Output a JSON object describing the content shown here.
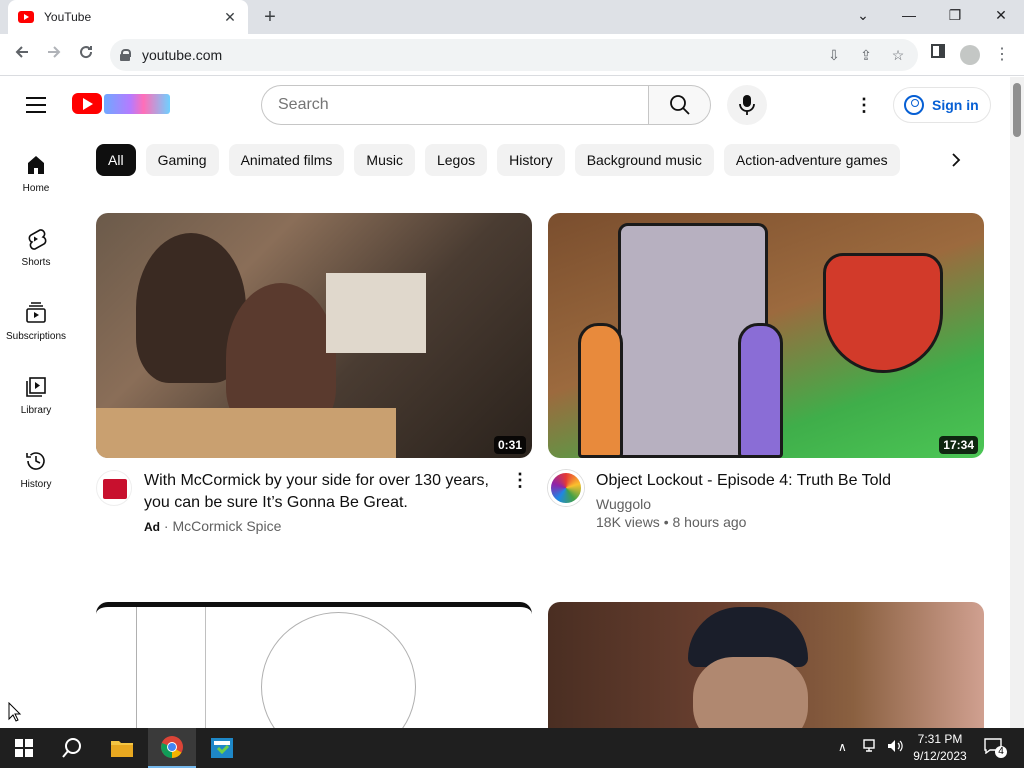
{
  "browser": {
    "tab_title": "YouTube",
    "url": "youtube.com"
  },
  "header": {
    "search_placeholder": "Search",
    "signin_label": "Sign in"
  },
  "sidebar": {
    "items": [
      {
        "label": "Home",
        "icon": "home-icon"
      },
      {
        "label": "Shorts",
        "icon": "shorts-icon"
      },
      {
        "label": "Subscriptions",
        "icon": "subscriptions-icon"
      },
      {
        "label": "Library",
        "icon": "library-icon"
      },
      {
        "label": "History",
        "icon": "history-icon"
      }
    ]
  },
  "chips": [
    "All",
    "Gaming",
    "Animated films",
    "Music",
    "Legos",
    "History",
    "Background music",
    "Action-adventure games"
  ],
  "videos": [
    {
      "title": "With McCormick by your side for over 130 years, you can be sure It’s Gonna Be Great.",
      "ad_label": "Ad",
      "channel": "McCormick Spice",
      "duration": "0:31",
      "separator": "·"
    },
    {
      "title": "Object Lockout - Episode 4: Truth Be Told",
      "channel": "Wuggolo",
      "stats": "18K views • 8 hours ago",
      "duration": "17:34"
    }
  ],
  "taskbar": {
    "time": "7:31 PM",
    "date": "9/12/2023",
    "notification_count": "4"
  },
  "colors": {
    "youtube_red": "#ff0000",
    "link_blue": "#065fd4",
    "chip_active": "#0f0f0f"
  }
}
